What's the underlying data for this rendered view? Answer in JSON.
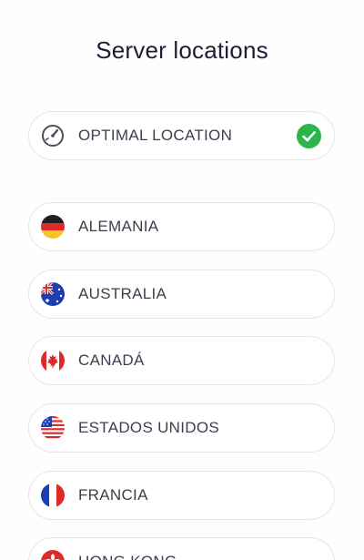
{
  "header": {
    "title": "Server locations"
  },
  "optimal": {
    "label": "OPTIMAL LOCATION",
    "icon": "speedometer-icon",
    "selected": true,
    "check_color": "#2bb54a"
  },
  "locations": [
    {
      "label": "ALEMANIA",
      "icon": "flag-germany-icon"
    },
    {
      "label": "AUSTRALIA",
      "icon": "flag-australia-icon"
    },
    {
      "label": "CANADÁ",
      "icon": "flag-canada-icon"
    },
    {
      "label": "ESTADOS UNIDOS",
      "icon": "flag-usa-icon"
    },
    {
      "label": "FRANCIA",
      "icon": "flag-france-icon"
    },
    {
      "label": "HONG KONG",
      "icon": "flag-hong-kong-icon"
    }
  ]
}
